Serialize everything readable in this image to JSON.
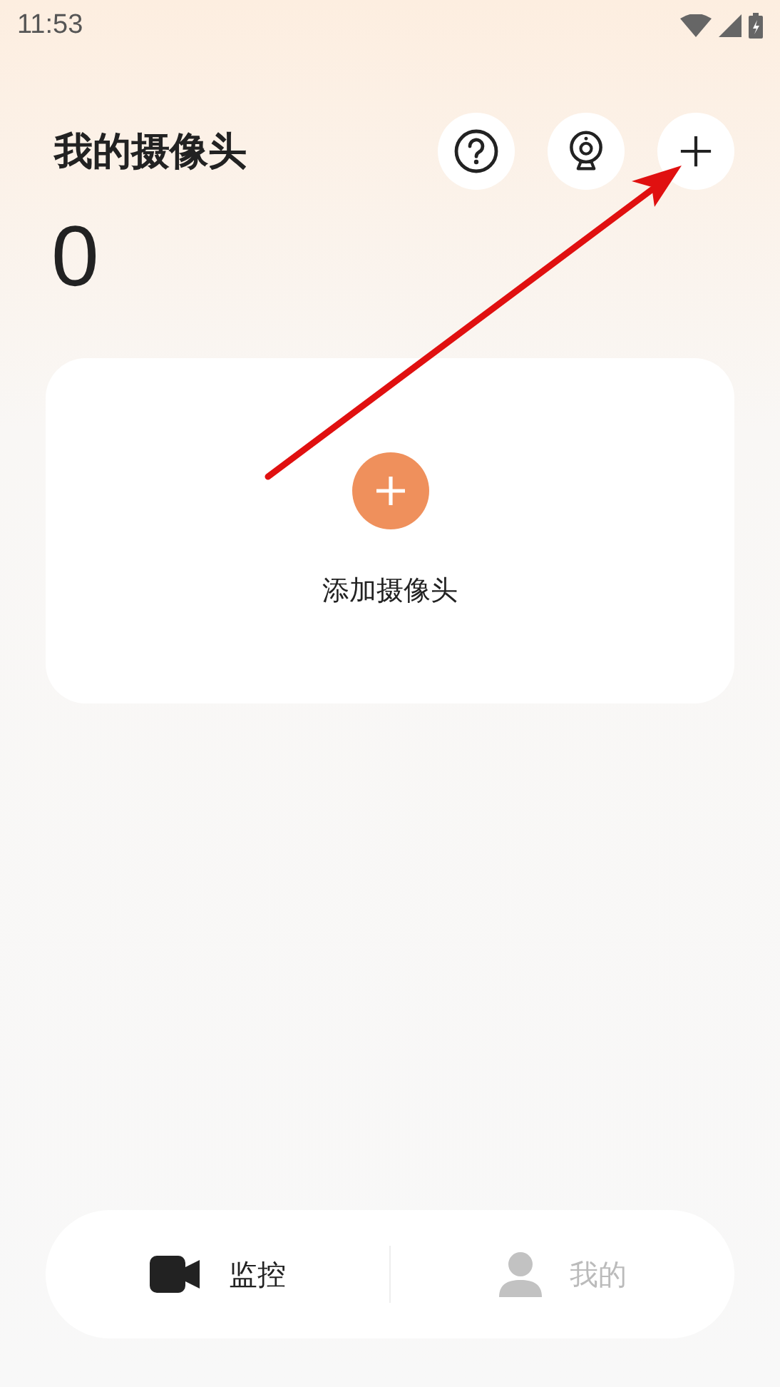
{
  "status_bar": {
    "time": "11:53"
  },
  "header": {
    "title": "我的摄像头",
    "count": "0"
  },
  "actions": [
    {
      "kind": "help"
    },
    {
      "kind": "camera"
    },
    {
      "kind": "add"
    }
  ],
  "add_card": {
    "label": "添加摄像头"
  },
  "tabs": [
    {
      "kind": "video",
      "label": "监控",
      "selected": true
    },
    {
      "kind": "person",
      "label": "我的",
      "selected": false
    }
  ]
}
